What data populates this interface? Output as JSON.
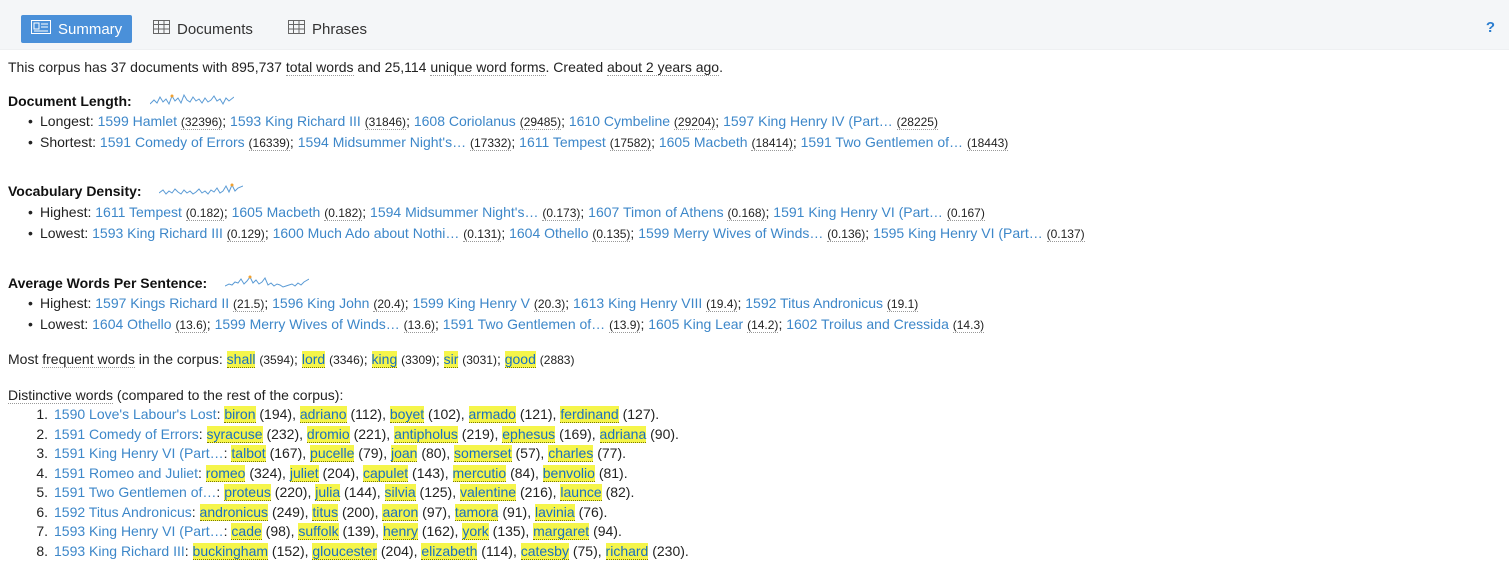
{
  "tabs": {
    "summary": "Summary",
    "documents": "Documents",
    "phrases": "Phrases",
    "help": "?"
  },
  "intro": {
    "prefix": "This corpus has 37 documents with 895,737 ",
    "total_words": "total words",
    "mid": " and 25,114 ",
    "unique": "unique word forms",
    "suffix": ". Created ",
    "created": "about 2 years ago",
    "end": "."
  },
  "doc_length": {
    "title": "Document Length:",
    "longest_label": "Longest: ",
    "longest": [
      {
        "name": "1599 Hamlet",
        "val": "(32396)"
      },
      {
        "name": "1593 King Richard III",
        "val": "(31846)"
      },
      {
        "name": "1608 Coriolanus",
        "val": "(29485)"
      },
      {
        "name": "1610 Cymbeline",
        "val": "(29204)"
      },
      {
        "name": "1597 King Henry IV (Part…",
        "val": "(28225)"
      }
    ],
    "shortest_label": "Shortest: ",
    "shortest": [
      {
        "name": "1591 Comedy of Errors",
        "val": "(16339)"
      },
      {
        "name": "1594 Midsummer Night's…",
        "val": "(17332)"
      },
      {
        "name": "1611 Tempest",
        "val": "(17582)"
      },
      {
        "name": "1605 Macbeth",
        "val": "(18414)"
      },
      {
        "name": "1591 Two Gentlemen of…",
        "val": "(18443)"
      }
    ]
  },
  "vocab": {
    "title": "Vocabulary Density:",
    "highest_label": "Highest: ",
    "highest": [
      {
        "name": "1611 Tempest",
        "val": "(0.182)"
      },
      {
        "name": "1605 Macbeth",
        "val": "(0.182)"
      },
      {
        "name": "1594 Midsummer Night's…",
        "val": "(0.173)"
      },
      {
        "name": "1607 Timon of Athens",
        "val": "(0.168)"
      },
      {
        "name": "1591 King Henry VI (Part…",
        "val": "(0.167)"
      }
    ],
    "lowest_label": "Lowest: ",
    "lowest": [
      {
        "name": "1593 King Richard III",
        "val": "(0.129)"
      },
      {
        "name": "1600 Much Ado about Nothi…",
        "val": "(0.131)"
      },
      {
        "name": "1604 Othello",
        "val": "(0.135)"
      },
      {
        "name": "1599 Merry Wives of Winds…",
        "val": "(0.136)"
      },
      {
        "name": "1595 King Henry VI (Part…",
        "val": "(0.137)"
      }
    ]
  },
  "avg": {
    "title": "Average Words Per Sentence:",
    "highest_label": "Highest: ",
    "highest": [
      {
        "name": "1597 Kings Richard II",
        "val": "(21.5)"
      },
      {
        "name": "1596 King John",
        "val": "(20.4)"
      },
      {
        "name": "1599 King Henry V",
        "val": "(20.3)"
      },
      {
        "name": "1613 King Henry VIII",
        "val": "(19.4)"
      },
      {
        "name": "1592 Titus Andronicus",
        "val": "(19.1)"
      }
    ],
    "lowest_label": "Lowest: ",
    "lowest": [
      {
        "name": "1604 Othello",
        "val": "(13.6)"
      },
      {
        "name": "1599 Merry Wives of Winds…",
        "val": "(13.6)"
      },
      {
        "name": "1591 Two Gentlemen of…",
        "val": "(13.9)"
      },
      {
        "name": "1605 King Lear",
        "val": "(14.2)"
      },
      {
        "name": "1602 Troilus and Cressida",
        "val": "(14.3)"
      }
    ]
  },
  "frequent": {
    "prefix": "Most ",
    "label": "frequent words",
    "suffix": " in the corpus: ",
    "words": [
      {
        "w": "shall",
        "c": "(3594)"
      },
      {
        "w": "lord",
        "c": "(3346)"
      },
      {
        "w": "king",
        "c": "(3309)"
      },
      {
        "w": "sir",
        "c": "(3031)"
      },
      {
        "w": "good",
        "c": "(2883)"
      }
    ]
  },
  "distinctive": {
    "label": "Distinctive words",
    "suffix": " (compared to the rest of the corpus):",
    "items": [
      {
        "n": "1.",
        "doc": "1590 Love's Labour's Lost",
        "words": [
          [
            "biron",
            "(194)"
          ],
          [
            "adriano",
            "(112)"
          ],
          [
            "boyet",
            "(102)"
          ],
          [
            "armado",
            "(121)"
          ],
          [
            "ferdinand",
            "(127)"
          ]
        ]
      },
      {
        "n": "2.",
        "doc": "1591 Comedy of Errors",
        "words": [
          [
            "syracuse",
            "(232)"
          ],
          [
            "dromio",
            "(221)"
          ],
          [
            "antipholus",
            "(219)"
          ],
          [
            "ephesus",
            "(169)"
          ],
          [
            "adriana",
            "(90)"
          ]
        ]
      },
      {
        "n": "3.",
        "doc": "1591 King Henry VI (Part…",
        "words": [
          [
            "talbot",
            "(167)"
          ],
          [
            "pucelle",
            "(79)"
          ],
          [
            "joan",
            "(80)"
          ],
          [
            "somerset",
            "(57)"
          ],
          [
            "charles",
            "(77)"
          ]
        ]
      },
      {
        "n": "4.",
        "doc": "1591 Romeo and Juliet",
        "words": [
          [
            "romeo",
            "(324)"
          ],
          [
            "juliet",
            "(204)"
          ],
          [
            "capulet",
            "(143)"
          ],
          [
            "mercutio",
            "(84)"
          ],
          [
            "benvolio",
            "(81)"
          ]
        ]
      },
      {
        "n": "5.",
        "doc": "1591 Two Gentlemen of…",
        "words": [
          [
            "proteus",
            "(220)"
          ],
          [
            "julia",
            "(144)"
          ],
          [
            "silvia",
            "(125)"
          ],
          [
            "valentine",
            "(216)"
          ],
          [
            "launce",
            "(82)"
          ]
        ]
      },
      {
        "n": "6.",
        "doc": "1592 Titus Andronicus",
        "words": [
          [
            "andronicus",
            "(249)"
          ],
          [
            "titus",
            "(200)"
          ],
          [
            "aaron",
            "(97)"
          ],
          [
            "tamora",
            "(91)"
          ],
          [
            "lavinia",
            "(76)"
          ]
        ]
      },
      {
        "n": "7.",
        "doc": "1593 King Henry VI (Part…",
        "words": [
          [
            "cade",
            "(98)"
          ],
          [
            "suffolk",
            "(139)"
          ],
          [
            "henry",
            "(162)"
          ],
          [
            "york",
            "(135)"
          ],
          [
            "margaret",
            "(94)"
          ]
        ]
      },
      {
        "n": "8.",
        "doc": "1593 King Richard III",
        "words": [
          [
            "buckingham",
            "(152)"
          ],
          [
            "gloucester",
            "(204)"
          ],
          [
            "elizabeth",
            "(114)"
          ],
          [
            "catesby",
            "(75)"
          ],
          [
            "richard",
            "(230)"
          ]
        ]
      }
    ]
  },
  "colors": {
    "accent": "#4a90d9",
    "link": "#3d87c9",
    "highlight": "#f5f54a",
    "sparkline": "#5b9bd5"
  }
}
